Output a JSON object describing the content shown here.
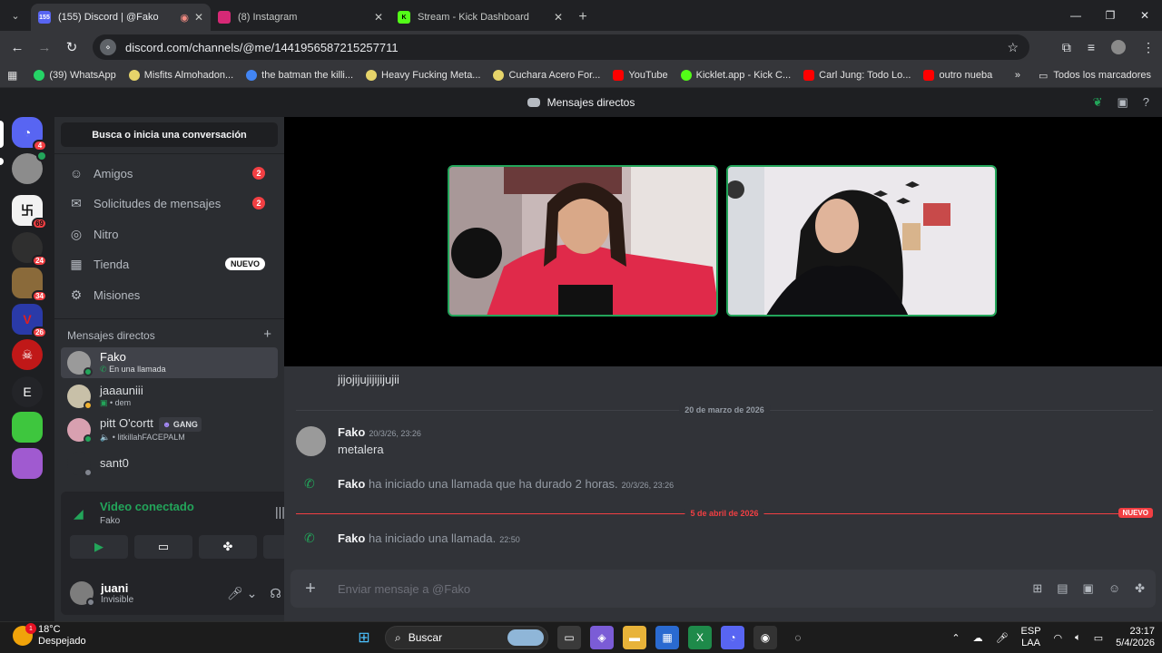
{
  "browser": {
    "tabs": [
      {
        "title": "(155) Discord | @Fako",
        "favicon_badge": "155",
        "active": true
      },
      {
        "title": "(8) Instagram",
        "active": false
      },
      {
        "title": "Stream - Kick Dashboard",
        "active": false
      }
    ],
    "url": "discord.com/channels/@me/1441956587215257711",
    "bookmarks": [
      {
        "label": "(39) WhatsApp",
        "color": "#25d366"
      },
      {
        "label": "Misfits Almohadon...",
        "color": "#e6d46a"
      },
      {
        "label": "the batman the killi...",
        "color": "#4285f4"
      },
      {
        "label": "Heavy Fucking Meta...",
        "color": "#e6d46a"
      },
      {
        "label": "Cuchara Acero For...",
        "color": "#e6d46a"
      },
      {
        "label": "YouTube",
        "color": "#ff0000"
      },
      {
        "label": "Kicklet.app - Kick C...",
        "color": "#53fc18"
      },
      {
        "label": "Carl Jung: Todo Lo...",
        "color": "#ff0000"
      },
      {
        "label": "outro nueba",
        "color": "#ff0000"
      }
    ],
    "all_bookmarks": "Todos los marcadores"
  },
  "discord": {
    "title": "Mensajes directos",
    "servers": [
      {
        "badge": "4"
      },
      {
        "badge": ""
      },
      {
        "badge": "69"
      },
      {
        "badge": "24"
      },
      {
        "badge": "34"
      },
      {
        "badge": "26"
      },
      {
        "badge": ""
      },
      {
        "letter": "E"
      },
      {
        "badge": ""
      },
      {
        "badge": ""
      }
    ],
    "search": "Busca o inicia una conversación",
    "nav": {
      "friends": "Amigos",
      "friends_count": "2",
      "requests": "Solicitudes de mensajes",
      "requests_count": "2",
      "nitro": "Nitro",
      "shop": "Tienda",
      "shop_badge": "NUEVO",
      "quests": "Misiones"
    },
    "dm_header": "Mensajes directos",
    "dms": [
      {
        "name": "Fako",
        "status": "En una llamada"
      },
      {
        "name": "jaaauniii",
        "status": "dem"
      },
      {
        "name": "pitt O'cortt",
        "tag": "GANG",
        "status": "litkillahFACEPALM"
      },
      {
        "name": "sant0",
        "status": ""
      }
    ],
    "voice": {
      "title": "Video conectado",
      "sub": "Fako"
    },
    "user": {
      "name": "juani",
      "status": "Invisible"
    },
    "chat": {
      "msg1": "jijojijujijijijujii",
      "date1": "20 de marzo de 2026",
      "author": "Fako",
      "time1": "20/3/26, 23:26",
      "msg2": "metalera",
      "call1_name": "Fako",
      "call1_text": "ha iniciado una llamada que ha durado 2 horas.",
      "call1_time": "20/3/26, 23:26",
      "date2": "5 de abril de 2026",
      "new_tag": "NUEVO",
      "call2_name": "Fako",
      "call2_text": "ha iniciado una llamada.",
      "call2_time": "22:50",
      "placeholder": "Enviar mensaje a @Fako"
    }
  },
  "taskbar": {
    "temp": "18°C",
    "weather": "Despejado",
    "weather_badge": "1",
    "search": "Buscar",
    "lang1": "ESP",
    "lang2": "LAA",
    "time": "23:17",
    "date": "5/4/2026"
  }
}
